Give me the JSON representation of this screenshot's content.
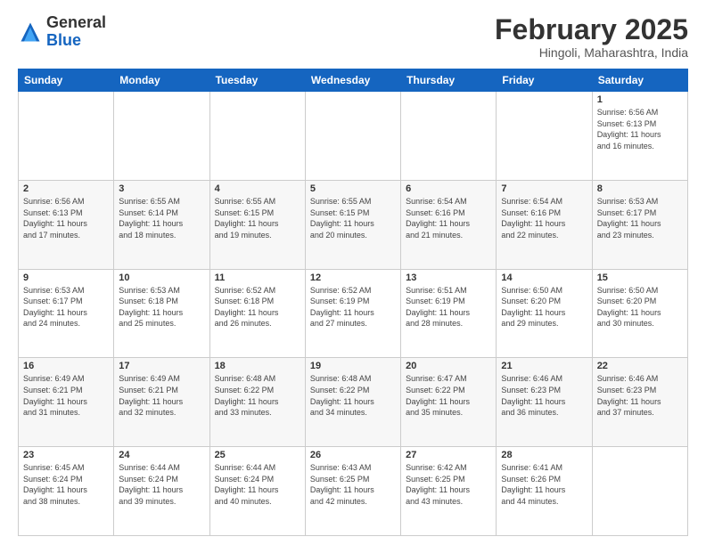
{
  "header": {
    "logo_general": "General",
    "logo_blue": "Blue",
    "month_title": "February 2025",
    "subtitle": "Hingoli, Maharashtra, India"
  },
  "days_of_week": [
    "Sunday",
    "Monday",
    "Tuesday",
    "Wednesday",
    "Thursday",
    "Friday",
    "Saturday"
  ],
  "weeks": [
    [
      {
        "day": "",
        "info": ""
      },
      {
        "day": "",
        "info": ""
      },
      {
        "day": "",
        "info": ""
      },
      {
        "day": "",
        "info": ""
      },
      {
        "day": "",
        "info": ""
      },
      {
        "day": "",
        "info": ""
      },
      {
        "day": "1",
        "info": "Sunrise: 6:56 AM\nSunset: 6:13 PM\nDaylight: 11 hours\nand 16 minutes."
      }
    ],
    [
      {
        "day": "2",
        "info": "Sunrise: 6:56 AM\nSunset: 6:13 PM\nDaylight: 11 hours\nand 17 minutes."
      },
      {
        "day": "3",
        "info": "Sunrise: 6:55 AM\nSunset: 6:14 PM\nDaylight: 11 hours\nand 18 minutes."
      },
      {
        "day": "4",
        "info": "Sunrise: 6:55 AM\nSunset: 6:15 PM\nDaylight: 11 hours\nand 19 minutes."
      },
      {
        "day": "5",
        "info": "Sunrise: 6:55 AM\nSunset: 6:15 PM\nDaylight: 11 hours\nand 20 minutes."
      },
      {
        "day": "6",
        "info": "Sunrise: 6:54 AM\nSunset: 6:16 PM\nDaylight: 11 hours\nand 21 minutes."
      },
      {
        "day": "7",
        "info": "Sunrise: 6:54 AM\nSunset: 6:16 PM\nDaylight: 11 hours\nand 22 minutes."
      },
      {
        "day": "8",
        "info": "Sunrise: 6:53 AM\nSunset: 6:17 PM\nDaylight: 11 hours\nand 23 minutes."
      }
    ],
    [
      {
        "day": "9",
        "info": "Sunrise: 6:53 AM\nSunset: 6:17 PM\nDaylight: 11 hours\nand 24 minutes."
      },
      {
        "day": "10",
        "info": "Sunrise: 6:53 AM\nSunset: 6:18 PM\nDaylight: 11 hours\nand 25 minutes."
      },
      {
        "day": "11",
        "info": "Sunrise: 6:52 AM\nSunset: 6:18 PM\nDaylight: 11 hours\nand 26 minutes."
      },
      {
        "day": "12",
        "info": "Sunrise: 6:52 AM\nSunset: 6:19 PM\nDaylight: 11 hours\nand 27 minutes."
      },
      {
        "day": "13",
        "info": "Sunrise: 6:51 AM\nSunset: 6:19 PM\nDaylight: 11 hours\nand 28 minutes."
      },
      {
        "day": "14",
        "info": "Sunrise: 6:50 AM\nSunset: 6:20 PM\nDaylight: 11 hours\nand 29 minutes."
      },
      {
        "day": "15",
        "info": "Sunrise: 6:50 AM\nSunset: 6:20 PM\nDaylight: 11 hours\nand 30 minutes."
      }
    ],
    [
      {
        "day": "16",
        "info": "Sunrise: 6:49 AM\nSunset: 6:21 PM\nDaylight: 11 hours\nand 31 minutes."
      },
      {
        "day": "17",
        "info": "Sunrise: 6:49 AM\nSunset: 6:21 PM\nDaylight: 11 hours\nand 32 minutes."
      },
      {
        "day": "18",
        "info": "Sunrise: 6:48 AM\nSunset: 6:22 PM\nDaylight: 11 hours\nand 33 minutes."
      },
      {
        "day": "19",
        "info": "Sunrise: 6:48 AM\nSunset: 6:22 PM\nDaylight: 11 hours\nand 34 minutes."
      },
      {
        "day": "20",
        "info": "Sunrise: 6:47 AM\nSunset: 6:22 PM\nDaylight: 11 hours\nand 35 minutes."
      },
      {
        "day": "21",
        "info": "Sunrise: 6:46 AM\nSunset: 6:23 PM\nDaylight: 11 hours\nand 36 minutes."
      },
      {
        "day": "22",
        "info": "Sunrise: 6:46 AM\nSunset: 6:23 PM\nDaylight: 11 hours\nand 37 minutes."
      }
    ],
    [
      {
        "day": "23",
        "info": "Sunrise: 6:45 AM\nSunset: 6:24 PM\nDaylight: 11 hours\nand 38 minutes."
      },
      {
        "day": "24",
        "info": "Sunrise: 6:44 AM\nSunset: 6:24 PM\nDaylight: 11 hours\nand 39 minutes."
      },
      {
        "day": "25",
        "info": "Sunrise: 6:44 AM\nSunset: 6:24 PM\nDaylight: 11 hours\nand 40 minutes."
      },
      {
        "day": "26",
        "info": "Sunrise: 6:43 AM\nSunset: 6:25 PM\nDaylight: 11 hours\nand 42 minutes."
      },
      {
        "day": "27",
        "info": "Sunrise: 6:42 AM\nSunset: 6:25 PM\nDaylight: 11 hours\nand 43 minutes."
      },
      {
        "day": "28",
        "info": "Sunrise: 6:41 AM\nSunset: 6:26 PM\nDaylight: 11 hours\nand 44 minutes."
      },
      {
        "day": "",
        "info": ""
      }
    ]
  ]
}
